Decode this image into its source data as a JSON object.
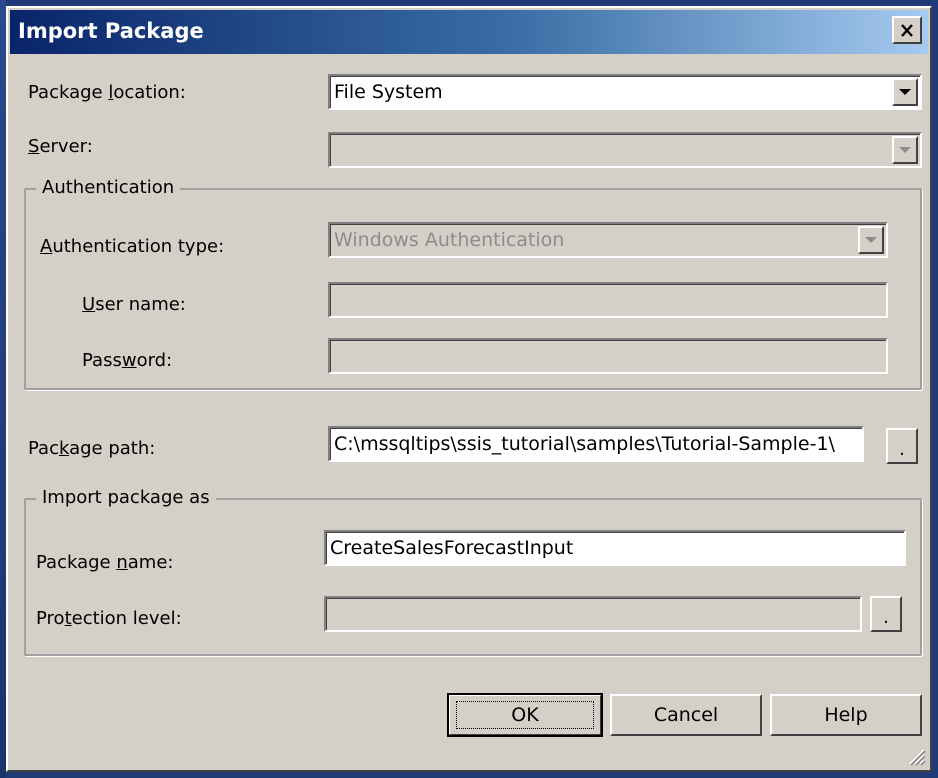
{
  "dialog": {
    "title": "Import Package",
    "close_glyph": "X"
  },
  "labels": {
    "package_location": {
      "pre": "Package ",
      "key": "l",
      "post": "ocation:"
    },
    "server": {
      "pre": "",
      "key": "S",
      "post": "erver:"
    },
    "authentication_group": "Authentication",
    "authentication_type": {
      "pre": "",
      "key": "A",
      "post": "uthentication type:"
    },
    "user_name": {
      "pre": "",
      "key": "U",
      "post": "ser name:"
    },
    "password": {
      "pre": "Pass",
      "key": "w",
      "post": "ord:"
    },
    "package_path": {
      "pre": "Pac",
      "key": "k",
      "post": "age path:"
    },
    "import_group": "Import package as",
    "package_name": {
      "pre": "Package ",
      "key": "n",
      "post": "ame:"
    },
    "protection_level": {
      "pre": "Pro",
      "key": "t",
      "post": "ection level:"
    }
  },
  "fields": {
    "package_location": "File System",
    "server": "",
    "authentication_type": "Windows Authentication",
    "user_name": "",
    "password": "",
    "package_path": "C:\\mssqltips\\ssis_tutorial\\samples\\Tutorial-Sample-1\\",
    "package_name": "CreateSalesForecastInput",
    "protection_level": ""
  },
  "buttons": {
    "browse_label": ".",
    "ok": "OK",
    "cancel": "Cancel",
    "help": "Help"
  },
  "icons": {
    "close": "close-icon",
    "dropdown": "chevron-down-icon",
    "resize": "resize-grip-icon"
  }
}
